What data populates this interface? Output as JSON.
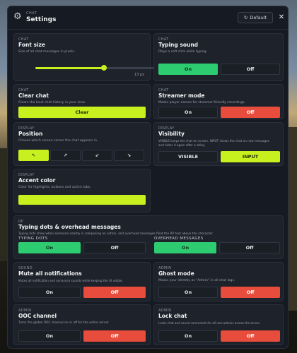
{
  "header": {
    "section": "CHAT",
    "title": "Settings",
    "default_label": "Default",
    "close": "✕",
    "default_icon": "↻"
  },
  "font_size": {
    "kicker": "CHAT",
    "title": "Font size",
    "desc": "Size of all chat messages in pixels.",
    "value": "13 px",
    "level": 0.57
  },
  "typing_sound": {
    "kicker": "CHAT",
    "title": "Typing sound",
    "desc": "Plays a soft click while typing.",
    "on": "On",
    "off": "Off",
    "state": "on"
  },
  "clear_chat": {
    "kicker": "CHAT",
    "title": "Clear chat",
    "desc": "Clears the local chat history in your view.",
    "button": "Clear"
  },
  "streamer": {
    "kicker": "CHAT",
    "title": "Streamer mode",
    "desc": "Masks player names for streamer-friendly recordings.",
    "on": "On",
    "off": "Off",
    "state": "off"
  },
  "position": {
    "kicker": "DISPLAY",
    "title": "Position",
    "desc": "Choose which screen corner the chat appears in.",
    "options": [
      "↖",
      "↗",
      "↙",
      "↘"
    ],
    "selected": 0
  },
  "visibility": {
    "kicker": "DISPLAY",
    "title": "Visibility",
    "desc": "VISIBLE keeps the chat on screen. INPUT shows the chat on new messages",
    "desc2": "and hides it again after a delay.",
    "visible": "VISIBLE",
    "input": "INPUT",
    "selected": "INPUT"
  },
  "accent": {
    "kicker": "DISPLAY",
    "title": "Accent color",
    "desc": "Color for highlights, buttons and active tabs.",
    "color": "#c6f01e"
  },
  "typing_dots": {
    "kicker": "RP",
    "title": "Typing dots & overhead messages",
    "desc": "Typing dots show when someone nearby is composing an action, and overhead messages float the RP text above the character.",
    "left_label": "TYPING DOTS",
    "right_label": "OVERHEAD MESSAGES",
    "on": "On",
    "off": "Off"
  },
  "mute": {
    "kicker": "SOUND",
    "title": "Mute all notifications",
    "desc": "Mutes all notification and announce sounds while keeping the UI visible.",
    "on": "On",
    "off": "Off"
  },
  "ghost": {
    "kicker": "ADMIN",
    "title": "Ghost mode",
    "desc": "Masks your identity as \"Admin\" in all chat logs.",
    "on": "On",
    "off": "Off"
  },
  "ooc": {
    "kicker": "ADMIN",
    "title": "OOC channel",
    "desc": "Turns the global OOC channel on or off for the entire server.",
    "on": "On",
    "off": "Off"
  },
  "lock": {
    "kicker": "ADMIN",
    "title": "Lock chat",
    "desc": "Locks chat and saved commands for all non-admins across the server.",
    "on": "On",
    "off": "Off"
  }
}
